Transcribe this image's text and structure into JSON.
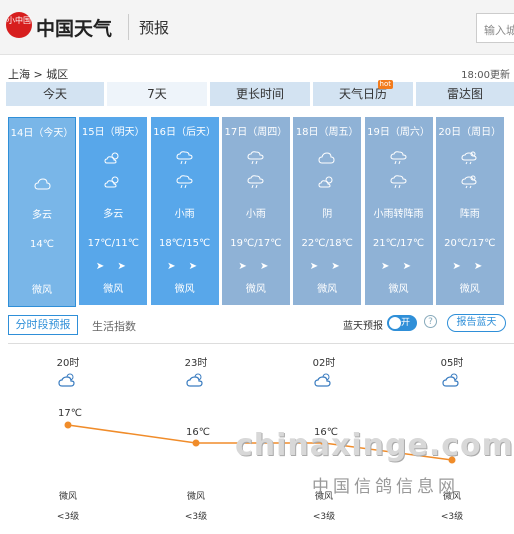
{
  "header": {
    "logo_text": "小中国",
    "brand": "中国天气",
    "section": "预报",
    "search_placeholder": "输入城市"
  },
  "breadcrumb": "上海 > 城区",
  "update_time": "18:00更新",
  "tabs": [
    {
      "label": "今天"
    },
    {
      "label": "7天"
    },
    {
      "label": "更长时间"
    },
    {
      "label": "天气日历",
      "badge": "hot"
    },
    {
      "label": "雷达图"
    }
  ],
  "days": [
    {
      "date": "14日（今天）",
      "desc": "多云",
      "temp": "14℃",
      "wind": "微风",
      "icons": [
        "cloud-icon"
      ],
      "color": "#79b6e8"
    },
    {
      "date": "15日（明天）",
      "desc": "多云",
      "temp": "17℃/11℃",
      "wind": "微风",
      "icons": [
        "sun-cloud-icon",
        "sun-cloud-icon"
      ],
      "color": "#58a7ea"
    },
    {
      "date": "16日（后天）",
      "desc": "小雨",
      "temp": "18℃/15℃",
      "wind": "微风",
      "icons": [
        "rain-icon",
        "rain-icon"
      ],
      "color": "#58a7ea"
    },
    {
      "date": "17日（周四）",
      "desc": "小雨",
      "temp": "19℃/17℃",
      "wind": "微风",
      "icons": [
        "rain-icon",
        "rain-icon"
      ],
      "color": "#8fb2d6"
    },
    {
      "date": "18日（周五）",
      "desc": "阴",
      "temp": "22℃/18℃",
      "wind": "微风",
      "icons": [
        "cloud-icon",
        "sun-cloud-icon"
      ],
      "color": "#8fb2d6"
    },
    {
      "date": "19日（周六）",
      "desc": "小雨转阵雨",
      "temp": "21℃/17℃",
      "wind": "微风",
      "icons": [
        "rain-icon",
        "rain-icon"
      ],
      "color": "#8fb2d6"
    },
    {
      "date": "20日（周日）",
      "desc": "阵雨",
      "temp": "20℃/17℃",
      "wind": "微风",
      "icons": [
        "shower-icon",
        "shower-icon"
      ],
      "color": "#8fb2d6"
    }
  ],
  "subtabs": {
    "hourly": "分时段预报",
    "life": "生活指数"
  },
  "blue_sky": {
    "label": "蓝天预报",
    "toggle": "开",
    "help": "?",
    "report": "报告蓝天"
  },
  "hourly": [
    {
      "time": "20时",
      "temp": "17℃",
      "wind": "微风",
      "level": "<3级"
    },
    {
      "time": "23时",
      "temp": "16℃",
      "wind": "微风",
      "level": "<3级"
    },
    {
      "time": "02时",
      "temp": "16℃",
      "wind": "微风",
      "level": "<3级"
    },
    {
      "time": "05时",
      "temp": "",
      "wind": "微风",
      "level": "<3级"
    }
  ],
  "watermark": {
    "domain": "chinaxinge.com",
    "cn": "中国信鸽信息网"
  },
  "colors": {
    "accent": "#2f8fd8",
    "line": "#f08c2a"
  }
}
